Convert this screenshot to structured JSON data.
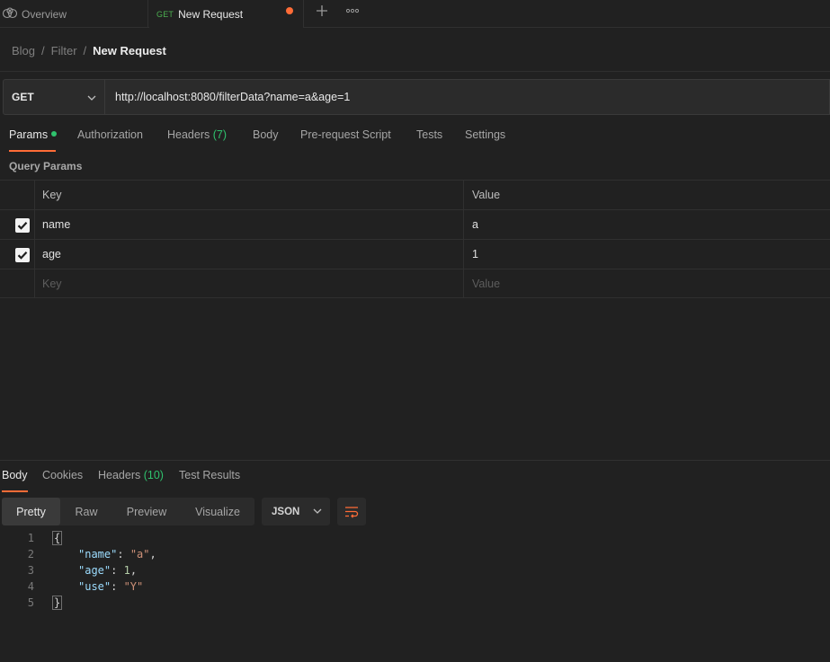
{
  "tabs": {
    "overview_label": "Overview",
    "active_method": "GET",
    "active_label": "New Request"
  },
  "breadcrumb": [
    "Blog",
    "Filter",
    "New Request"
  ],
  "request": {
    "method": "GET",
    "url": "http://localhost:8080/filterData?name=a&age=1"
  },
  "request_tabs": {
    "params": "Params",
    "authorization": "Authorization",
    "headers": "Headers",
    "headers_count": "(7)",
    "body": "Body",
    "prerequest": "Pre-request Script",
    "tests": "Tests",
    "settings": "Settings"
  },
  "query_params": {
    "title": "Query Params",
    "header_key": "Key",
    "header_value": "Value",
    "rows": [
      {
        "key": "name",
        "value": "a",
        "checked": true
      },
      {
        "key": "age",
        "value": "1",
        "checked": true
      }
    ],
    "placeholder_key": "Key",
    "placeholder_value": "Value"
  },
  "response_tabs": {
    "body": "Body",
    "cookies": "Cookies",
    "headers": "Headers",
    "headers_count": "(10)",
    "test_results": "Test Results"
  },
  "view_modes": [
    "Pretty",
    "Raw",
    "Preview",
    "Visualize"
  ],
  "format": "JSON",
  "response_body": {
    "line_numbers": [
      "1",
      "2",
      "3",
      "4",
      "5"
    ],
    "open_brace": "{",
    "close_brace": "}",
    "fields": [
      {
        "key": "\"name\"",
        "value": "\"a\"",
        "type": "string",
        "trail": ","
      },
      {
        "key": "\"age\"",
        "value": "1",
        "type": "number",
        "trail": ","
      },
      {
        "key": "\"use\"",
        "value": "\"Y\"",
        "type": "string",
        "trail": ""
      }
    ]
  },
  "colors": {
    "accent": "#ff6c37",
    "method_green": "#4caf50",
    "count_green": "#2fc26d",
    "json_key": "#9cdcfe",
    "json_string": "#ce9178",
    "json_number": "#b5cea8"
  }
}
